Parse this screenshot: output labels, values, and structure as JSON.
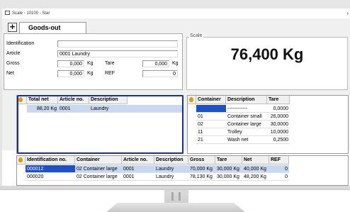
{
  "window": {
    "title": "Scale - 10100 - Star"
  },
  "toolbar": {
    "add_label": "+"
  },
  "tab": {
    "label": "Goods-out"
  },
  "fields": {
    "identification": {
      "label": "Identification",
      "value": ""
    },
    "article": {
      "label": "Article",
      "value": "0001  Laundry"
    },
    "gross": {
      "label": "Gross",
      "value": "0,000",
      "unit": "Kg"
    },
    "tare": {
      "label": "Tare",
      "value": "0,000",
      "unit": "Kg"
    },
    "net": {
      "label": "Net",
      "value": "0,000",
      "unit": "Kg"
    },
    "ref": {
      "label": "REF",
      "value": "0"
    }
  },
  "scale": {
    "label": "Scale",
    "reading": "76,400 Kg"
  },
  "left_table": {
    "headers": [
      "Total net",
      "Article no.",
      "Description"
    ],
    "rows": [
      [
        "88,20 Kg",
        "0001",
        "Laundry"
      ]
    ]
  },
  "container_table": {
    "headers": [
      "Container",
      "Description",
      "Tare"
    ],
    "rows": [
      [
        "",
        "------------",
        "0,0000"
      ],
      [
        "01",
        "Container small",
        "26,0000"
      ],
      [
        "02",
        "Container large",
        "30,0000"
      ],
      [
        "11",
        "Trolley",
        "10,0000"
      ],
      [
        "21",
        "Wash net",
        "0,2500"
      ]
    ]
  },
  "bottom_table": {
    "headers": [
      "Identification no.",
      "Container",
      "Article no.",
      "Description",
      "Gross",
      "Tare",
      "Net",
      "REF"
    ],
    "rows": [
      [
        "000012",
        "02  Container large",
        "0001",
        "Laundry",
        "70,000 Kg",
        "30,000 Kg",
        "40,000 Kg",
        "0"
      ],
      [
        "000020",
        "02  Container large",
        "0001",
        "Laundry",
        "78,130 Kg",
        "30,000 Kg",
        "48,200 Kg",
        "0"
      ]
    ]
  },
  "colors": {
    "selection": "#1e50c8",
    "highlight_border": "#1a2f99",
    "pin": "#d8a000"
  }
}
